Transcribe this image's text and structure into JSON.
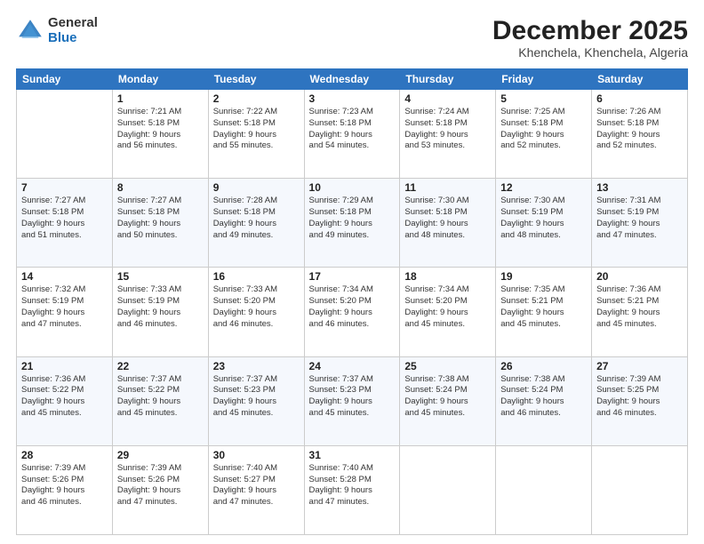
{
  "logo": {
    "general": "General",
    "blue": "Blue"
  },
  "header": {
    "title": "December 2025",
    "subtitle": "Khenchela, Khenchela, Algeria"
  },
  "days_of_week": [
    "Sunday",
    "Monday",
    "Tuesday",
    "Wednesday",
    "Thursday",
    "Friday",
    "Saturday"
  ],
  "weeks": [
    [
      {
        "day": "",
        "info": ""
      },
      {
        "day": "1",
        "info": "Sunrise: 7:21 AM\nSunset: 5:18 PM\nDaylight: 9 hours\nand 56 minutes."
      },
      {
        "day": "2",
        "info": "Sunrise: 7:22 AM\nSunset: 5:18 PM\nDaylight: 9 hours\nand 55 minutes."
      },
      {
        "day": "3",
        "info": "Sunrise: 7:23 AM\nSunset: 5:18 PM\nDaylight: 9 hours\nand 54 minutes."
      },
      {
        "day": "4",
        "info": "Sunrise: 7:24 AM\nSunset: 5:18 PM\nDaylight: 9 hours\nand 53 minutes."
      },
      {
        "day": "5",
        "info": "Sunrise: 7:25 AM\nSunset: 5:18 PM\nDaylight: 9 hours\nand 52 minutes."
      },
      {
        "day": "6",
        "info": "Sunrise: 7:26 AM\nSunset: 5:18 PM\nDaylight: 9 hours\nand 52 minutes."
      }
    ],
    [
      {
        "day": "7",
        "info": "Sunrise: 7:27 AM\nSunset: 5:18 PM\nDaylight: 9 hours\nand 51 minutes."
      },
      {
        "day": "8",
        "info": "Sunrise: 7:27 AM\nSunset: 5:18 PM\nDaylight: 9 hours\nand 50 minutes."
      },
      {
        "day": "9",
        "info": "Sunrise: 7:28 AM\nSunset: 5:18 PM\nDaylight: 9 hours\nand 49 minutes."
      },
      {
        "day": "10",
        "info": "Sunrise: 7:29 AM\nSunset: 5:18 PM\nDaylight: 9 hours\nand 49 minutes."
      },
      {
        "day": "11",
        "info": "Sunrise: 7:30 AM\nSunset: 5:18 PM\nDaylight: 9 hours\nand 48 minutes."
      },
      {
        "day": "12",
        "info": "Sunrise: 7:30 AM\nSunset: 5:19 PM\nDaylight: 9 hours\nand 48 minutes."
      },
      {
        "day": "13",
        "info": "Sunrise: 7:31 AM\nSunset: 5:19 PM\nDaylight: 9 hours\nand 47 minutes."
      }
    ],
    [
      {
        "day": "14",
        "info": "Sunrise: 7:32 AM\nSunset: 5:19 PM\nDaylight: 9 hours\nand 47 minutes."
      },
      {
        "day": "15",
        "info": "Sunrise: 7:33 AM\nSunset: 5:19 PM\nDaylight: 9 hours\nand 46 minutes."
      },
      {
        "day": "16",
        "info": "Sunrise: 7:33 AM\nSunset: 5:20 PM\nDaylight: 9 hours\nand 46 minutes."
      },
      {
        "day": "17",
        "info": "Sunrise: 7:34 AM\nSunset: 5:20 PM\nDaylight: 9 hours\nand 46 minutes."
      },
      {
        "day": "18",
        "info": "Sunrise: 7:34 AM\nSunset: 5:20 PM\nDaylight: 9 hours\nand 45 minutes."
      },
      {
        "day": "19",
        "info": "Sunrise: 7:35 AM\nSunset: 5:21 PM\nDaylight: 9 hours\nand 45 minutes."
      },
      {
        "day": "20",
        "info": "Sunrise: 7:36 AM\nSunset: 5:21 PM\nDaylight: 9 hours\nand 45 minutes."
      }
    ],
    [
      {
        "day": "21",
        "info": "Sunrise: 7:36 AM\nSunset: 5:22 PM\nDaylight: 9 hours\nand 45 minutes."
      },
      {
        "day": "22",
        "info": "Sunrise: 7:37 AM\nSunset: 5:22 PM\nDaylight: 9 hours\nand 45 minutes."
      },
      {
        "day": "23",
        "info": "Sunrise: 7:37 AM\nSunset: 5:23 PM\nDaylight: 9 hours\nand 45 minutes."
      },
      {
        "day": "24",
        "info": "Sunrise: 7:37 AM\nSunset: 5:23 PM\nDaylight: 9 hours\nand 45 minutes."
      },
      {
        "day": "25",
        "info": "Sunrise: 7:38 AM\nSunset: 5:24 PM\nDaylight: 9 hours\nand 45 minutes."
      },
      {
        "day": "26",
        "info": "Sunrise: 7:38 AM\nSunset: 5:24 PM\nDaylight: 9 hours\nand 46 minutes."
      },
      {
        "day": "27",
        "info": "Sunrise: 7:39 AM\nSunset: 5:25 PM\nDaylight: 9 hours\nand 46 minutes."
      }
    ],
    [
      {
        "day": "28",
        "info": "Sunrise: 7:39 AM\nSunset: 5:26 PM\nDaylight: 9 hours\nand 46 minutes."
      },
      {
        "day": "29",
        "info": "Sunrise: 7:39 AM\nSunset: 5:26 PM\nDaylight: 9 hours\nand 47 minutes."
      },
      {
        "day": "30",
        "info": "Sunrise: 7:40 AM\nSunset: 5:27 PM\nDaylight: 9 hours\nand 47 minutes."
      },
      {
        "day": "31",
        "info": "Sunrise: 7:40 AM\nSunset: 5:28 PM\nDaylight: 9 hours\nand 47 minutes."
      },
      {
        "day": "",
        "info": ""
      },
      {
        "day": "",
        "info": ""
      },
      {
        "day": "",
        "info": ""
      }
    ]
  ]
}
